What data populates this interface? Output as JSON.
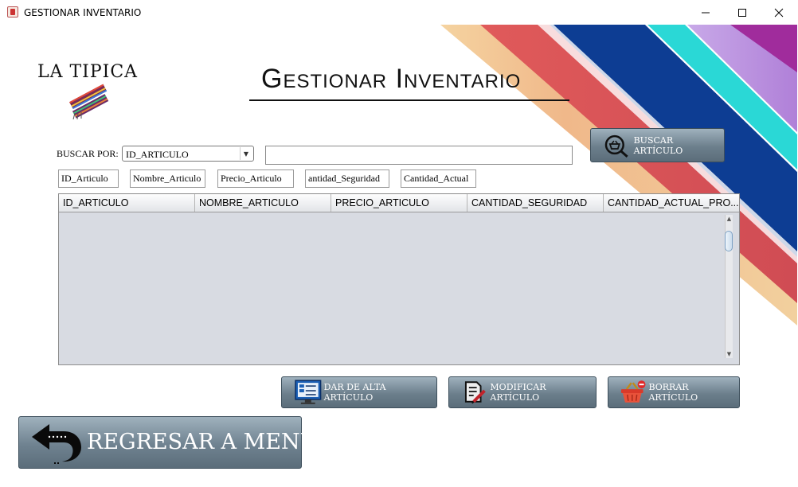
{
  "window": {
    "title": "GESTIONAR INVENTARIO"
  },
  "logo": {
    "text": "LA TIPICA"
  },
  "page_title": "Gestionar Inventario",
  "search": {
    "label": "BUSCAR POR:",
    "combo_value": "ID_ARTICULO",
    "input_value": "",
    "button_label": "BUSCAR ARTÍCULO"
  },
  "filters": [
    "ID_Articulo",
    "Nombre_Articulo",
    "Precio_Articulo",
    "antidad_Seguridad",
    "Cantidad_Actual"
  ],
  "table": {
    "columns": [
      "ID_ARTICULO",
      "NOMBRE_ARTICULO",
      "PRECIO_ARTICULO",
      "CANTIDAD_SEGURIDAD",
      "CANTIDAD_ACTUAL_PRO..."
    ],
    "rows": []
  },
  "actions": {
    "add_label": "DAR DE ALTA ARTÍCULO",
    "edit_label": "MODIFICAR ARTÍCULO",
    "delete_label": "BORRAR ARTÍCULO"
  },
  "back": {
    "label": "REGRESAR A MENÚ"
  },
  "colors": {
    "button_top": "#9fb1bd",
    "button_bottom": "#5b6d7a",
    "table_bg": "#d8dbe2"
  }
}
